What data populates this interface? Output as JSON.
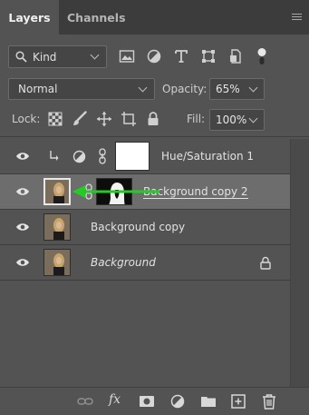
{
  "tabs": [
    {
      "label": "Layers",
      "active": true
    },
    {
      "label": "Channels",
      "active": false
    }
  ],
  "panel_menu_icon": "hamburger-menu-icon",
  "filter": {
    "kind_label": "Kind",
    "icons": [
      "image-filter-icon",
      "adjustment-filter-icon",
      "type-filter-icon",
      "shape-filter-icon",
      "smart-object-filter-icon",
      "filter-toggle-icon"
    ]
  },
  "blend": {
    "mode": "Normal",
    "opacity_label": "Opacity:",
    "opacity_value": "65%"
  },
  "lock": {
    "label": "Lock:",
    "icons": [
      "lock-transparent-pixels-icon",
      "lock-image-pixels-icon",
      "lock-position-icon",
      "lock-artboard-icon",
      "lock-all-icon"
    ],
    "fill_label": "Fill:",
    "fill_value": "100%"
  },
  "layers": [
    {
      "name": "Hue/Saturation 1",
      "type": "adjustment",
      "clipped": true,
      "italic": false,
      "selected": false
    },
    {
      "name": "Background copy 2",
      "type": "masked-image",
      "clipped": false,
      "italic": false,
      "selected": true
    },
    {
      "name": "Background copy",
      "type": "image",
      "clipped": false,
      "italic": false,
      "selected": false
    },
    {
      "name": "Background",
      "type": "image",
      "clipped": false,
      "italic": true,
      "selected": false,
      "locked": true
    }
  ],
  "annotation_color": "#22cc22",
  "bottom_toolbar": {
    "fx_label": "fx",
    "icons": [
      "link-layers-icon",
      "layer-style-icon",
      "add-mask-icon",
      "new-adjustment-icon",
      "new-group-icon",
      "new-layer-icon",
      "delete-layer-icon"
    ]
  }
}
